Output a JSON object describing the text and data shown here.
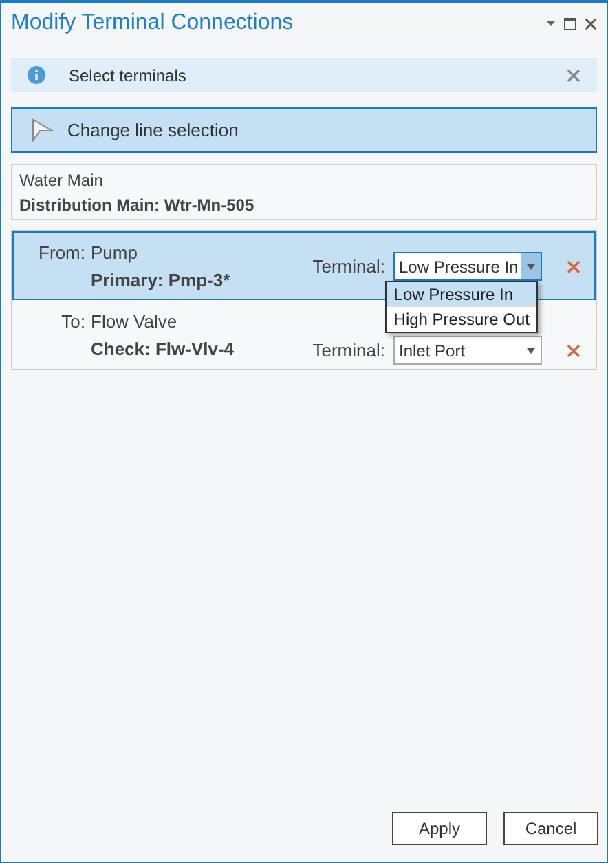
{
  "window": {
    "title": "Modify Terminal Connections"
  },
  "info_bar": {
    "message": "Select terminals"
  },
  "change_selection_button": {
    "label": "Change line selection",
    "selected": true
  },
  "line": {
    "layer": "Water Main",
    "feature": "Distribution Main: Wtr-Mn-505"
  },
  "connections": [
    {
      "role": "From:",
      "layer": "Pump",
      "feature": "Primary: Pmp-3*",
      "terminal_label": "Terminal:",
      "terminal": "Low Pressure In",
      "selected": true,
      "expanded": true,
      "options": [
        {
          "label": "Low Pressure In",
          "selected": true
        },
        {
          "label": "High Pressure Out",
          "selected": false
        }
      ]
    },
    {
      "role": "To:",
      "layer": "Flow Valve",
      "feature": "Check: Flw-Vlv-4",
      "terminal_label": "Terminal:",
      "terminal": "Inlet Port",
      "selected": false,
      "expanded": false
    }
  ],
  "buttons": [
    "Apply",
    "Cancel"
  ]
}
